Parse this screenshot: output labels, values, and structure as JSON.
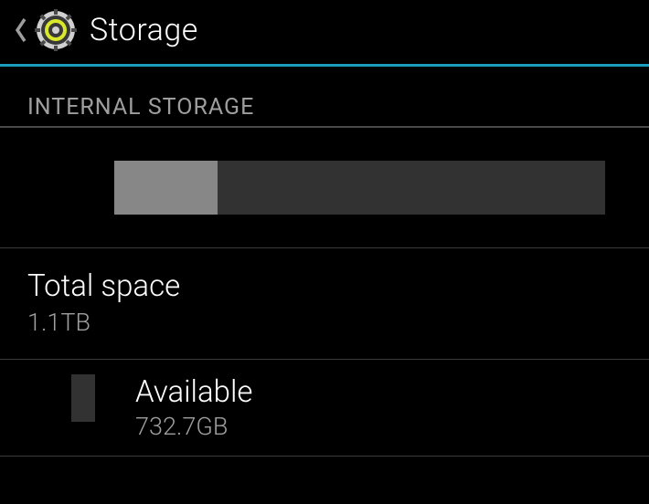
{
  "header": {
    "title": "Storage"
  },
  "section": {
    "label": "INTERNAL STORAGE"
  },
  "progress": {
    "used_percent": 21
  },
  "total": {
    "label": "Total space",
    "value": "1.1TB"
  },
  "available": {
    "label": "Available",
    "value": "732.7GB"
  }
}
